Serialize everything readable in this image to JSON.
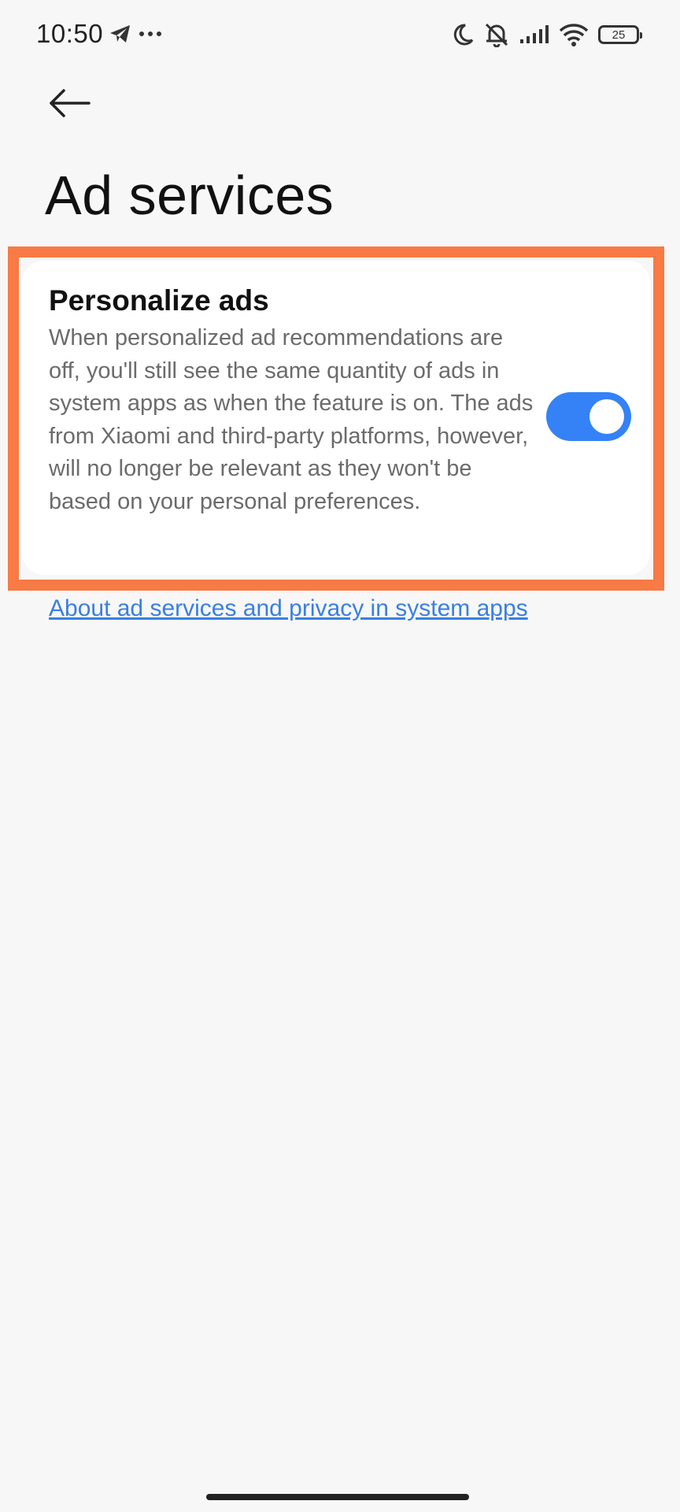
{
  "status_bar": {
    "time": "10:50",
    "left_icons": [
      "telegram-icon",
      "more-dots-icon"
    ],
    "right_icons": [
      "moon-icon",
      "silent-bell-icon",
      "signal-icon",
      "wifi-icon",
      "battery-icon"
    ],
    "battery_level": "25"
  },
  "header": {
    "back_icon": "back-arrow-icon",
    "title": "Ad services"
  },
  "setting": {
    "title": "Personalize ads",
    "description": "When personalized ad recommendations are off, you'll still see the same quantity of ads in system apps as when the feature is on. The ads from Xiaomi and third-party platforms, however, will no longer be relevant as they won't be based on your personal preferences.",
    "toggle_on": true
  },
  "link": {
    "label": "About ad services and privacy in system apps"
  },
  "colors": {
    "accent": "#3482f6",
    "link": "#3a7fe0",
    "highlight": "#f87a44",
    "background": "#f7f7f7"
  }
}
